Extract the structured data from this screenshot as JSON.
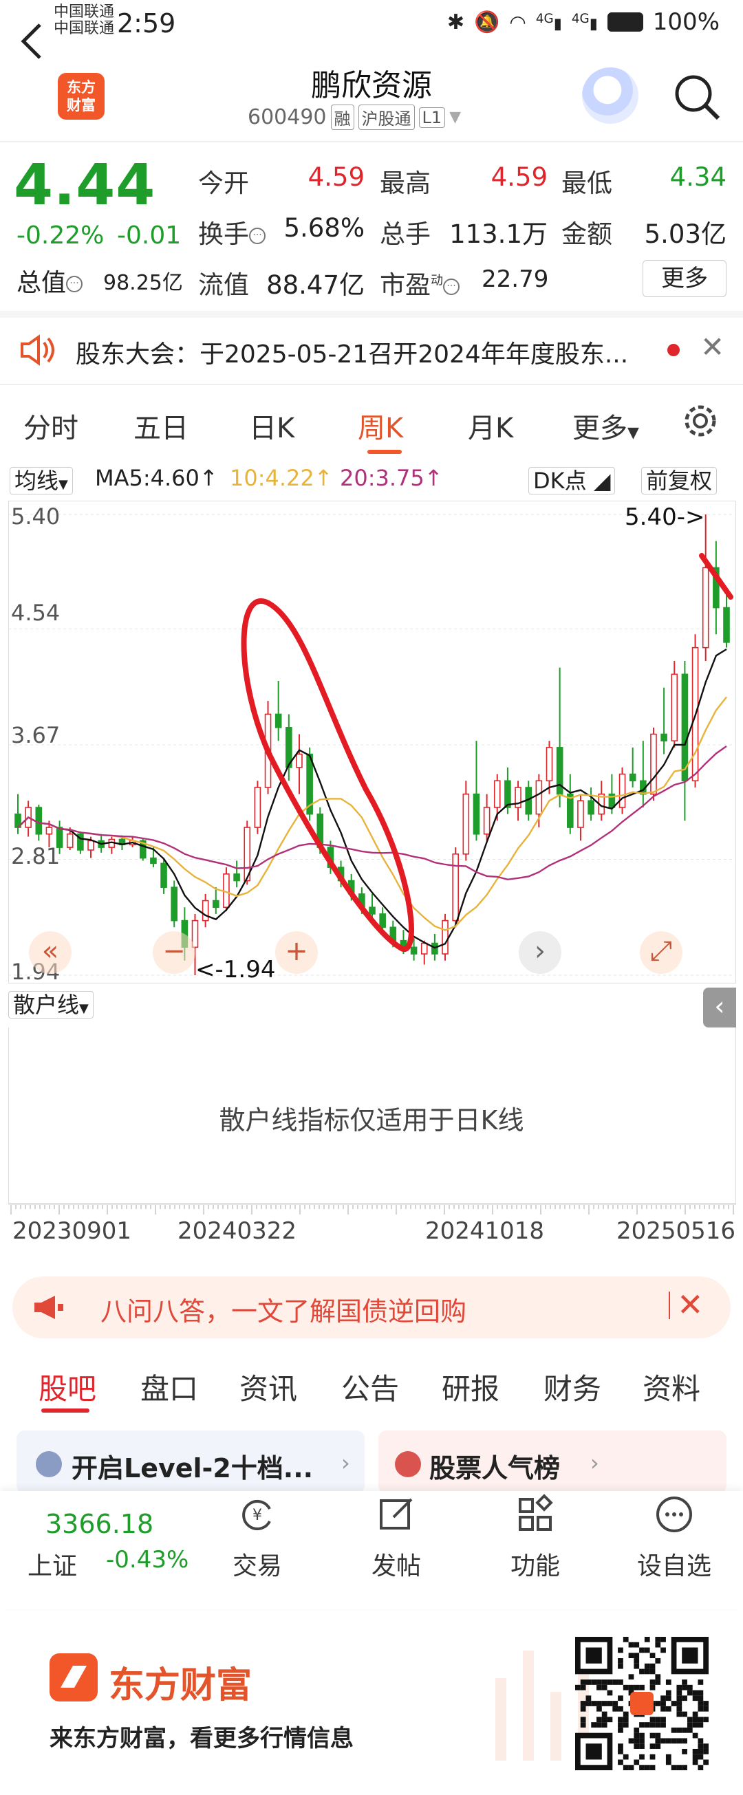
{
  "status_bar": {
    "carrier1": "中国联通",
    "carrier2": "中国联通",
    "time": "2:59",
    "battery": "100%",
    "network1": "4G",
    "network2": "4G"
  },
  "header": {
    "logo_line1": "东方",
    "logo_line2": "财富",
    "stock_name": "鹏欣资源",
    "code": "600490",
    "tag_margin": "融",
    "tag_connect": "沪股通",
    "tag_level": "L1"
  },
  "quote": {
    "price": "4.44",
    "change_pct": "-0.22%",
    "change": "-0.01",
    "market_cap_label": "总值",
    "market_cap": "98.25亿",
    "open_label": "今开",
    "open": "4.59",
    "high_label": "最高",
    "high": "4.59",
    "low_label": "最低",
    "low": "4.34",
    "turnover_label": "换手",
    "turnover": "5.68%",
    "volume_label": "总手",
    "volume": "113.1万",
    "amount_label": "金额",
    "amount": "5.03亿",
    "float_cap_label": "流值",
    "float_cap": "88.47亿",
    "pe_label": "市盈",
    "pe_sup": "动",
    "pe": "22.79",
    "more_label": "更多"
  },
  "notice": {
    "text": "股东大会：于2025-05-21召开2024年年度股东..."
  },
  "kline_tabs": {
    "items": [
      "分时",
      "五日",
      "日K",
      "周K",
      "月K",
      "更多"
    ],
    "active": "周K"
  },
  "ma_row": {
    "selector": "均线",
    "ma5": "MA5:4.60",
    "ma10": "10:4.22",
    "ma20": "20:3.75",
    "dk": "DK点",
    "adjust": "前复权"
  },
  "chart_data": {
    "type": "candlestick",
    "period": "weekly",
    "y_ticks": [
      "5.40",
      "4.54",
      "3.67",
      "2.81",
      "1.94"
    ],
    "ylim": [
      1.94,
      5.4
    ],
    "x_ticks": [
      "20230901",
      "20240322",
      "20241018",
      "20250516"
    ],
    "max_label": "5.40->",
    "min_label": "<-1.94",
    "up_color": "#e0262d",
    "down_color": "#1f9d2a",
    "ma_colors": {
      "ma5": "#111111",
      "ma10": "#e8b33b",
      "ma20": "#b0307a"
    },
    "candles": [
      {
        "o": 3.15,
        "h": 3.3,
        "l": 3.0,
        "c": 3.05
      },
      {
        "o": 3.05,
        "h": 3.25,
        "l": 2.98,
        "c": 3.2
      },
      {
        "o": 3.2,
        "h": 3.22,
        "l": 2.95,
        "c": 3.0
      },
      {
        "o": 3.0,
        "h": 3.1,
        "l": 2.9,
        "c": 3.05
      },
      {
        "o": 3.05,
        "h": 3.1,
        "l": 2.85,
        "c": 2.9
      },
      {
        "o": 2.9,
        "h": 3.05,
        "l": 2.88,
        "c": 3.0
      },
      {
        "o": 3.0,
        "h": 3.02,
        "l": 2.85,
        "c": 2.88
      },
      {
        "o": 2.88,
        "h": 2.98,
        "l": 2.82,
        "c": 2.95
      },
      {
        "o": 2.95,
        "h": 3.0,
        "l": 2.86,
        "c": 2.9
      },
      {
        "o": 2.9,
        "h": 2.98,
        "l": 2.85,
        "c": 2.96
      },
      {
        "o": 2.96,
        "h": 2.99,
        "l": 2.88,
        "c": 2.92
      },
      {
        "o": 2.92,
        "h": 2.98,
        "l": 2.9,
        "c": 2.95
      },
      {
        "o": 2.95,
        "h": 2.97,
        "l": 2.8,
        "c": 2.82
      },
      {
        "o": 2.82,
        "h": 2.9,
        "l": 2.75,
        "c": 2.78
      },
      {
        "o": 2.78,
        "h": 2.82,
        "l": 2.55,
        "c": 2.6
      },
      {
        "o": 2.6,
        "h": 2.65,
        "l": 2.3,
        "c": 2.35
      },
      {
        "o": 2.35,
        "h": 2.45,
        "l": 2.05,
        "c": 2.15
      },
      {
        "o": 2.15,
        "h": 2.4,
        "l": 1.94,
        "c": 2.35
      },
      {
        "o": 2.35,
        "h": 2.55,
        "l": 2.3,
        "c": 2.5
      },
      {
        "o": 2.5,
        "h": 2.6,
        "l": 2.4,
        "c": 2.45
      },
      {
        "o": 2.45,
        "h": 2.75,
        "l": 2.42,
        "c": 2.7
      },
      {
        "o": 2.7,
        "h": 2.8,
        "l": 2.6,
        "c": 2.65
      },
      {
        "o": 2.65,
        "h": 3.1,
        "l": 2.62,
        "c": 3.05
      },
      {
        "o": 3.05,
        "h": 3.4,
        "l": 3.0,
        "c": 3.35
      },
      {
        "o": 3.35,
        "h": 4.0,
        "l": 3.3,
        "c": 3.9
      },
      {
        "o": 3.9,
        "h": 4.15,
        "l": 3.7,
        "c": 3.8
      },
      {
        "o": 3.8,
        "h": 3.9,
        "l": 3.4,
        "c": 3.5
      },
      {
        "o": 3.5,
        "h": 3.75,
        "l": 3.3,
        "c": 3.6
      },
      {
        "o": 3.6,
        "h": 3.65,
        "l": 3.1,
        "c": 3.15
      },
      {
        "o": 3.15,
        "h": 3.2,
        "l": 2.85,
        "c": 2.9
      },
      {
        "o": 2.9,
        "h": 2.95,
        "l": 2.7,
        "c": 2.75
      },
      {
        "o": 2.75,
        "h": 2.8,
        "l": 2.6,
        "c": 2.65
      },
      {
        "o": 2.65,
        "h": 2.7,
        "l": 2.5,
        "c": 2.55
      },
      {
        "o": 2.55,
        "h": 2.6,
        "l": 2.4,
        "c": 2.45
      },
      {
        "o": 2.45,
        "h": 2.55,
        "l": 2.35,
        "c": 2.4
      },
      {
        "o": 2.4,
        "h": 2.45,
        "l": 2.25,
        "c": 2.3
      },
      {
        "o": 2.3,
        "h": 2.35,
        "l": 2.15,
        "c": 2.2
      },
      {
        "o": 2.2,
        "h": 2.28,
        "l": 2.1,
        "c": 2.15
      },
      {
        "o": 2.15,
        "h": 2.22,
        "l": 2.05,
        "c": 2.1
      },
      {
        "o": 2.1,
        "h": 2.2,
        "l": 2.02,
        "c": 2.18
      },
      {
        "o": 2.18,
        "h": 2.25,
        "l": 2.05,
        "c": 2.1
      },
      {
        "o": 2.1,
        "h": 2.4,
        "l": 2.05,
        "c": 2.35
      },
      {
        "o": 2.35,
        "h": 2.9,
        "l": 2.3,
        "c": 2.85
      },
      {
        "o": 2.85,
        "h": 3.4,
        "l": 2.8,
        "c": 3.3
      },
      {
        "o": 3.3,
        "h": 3.7,
        "l": 2.95,
        "c": 3.0
      },
      {
        "o": 3.0,
        "h": 3.3,
        "l": 2.95,
        "c": 3.2
      },
      {
        "o": 3.2,
        "h": 3.45,
        "l": 3.1,
        "c": 3.4
      },
      {
        "o": 3.4,
        "h": 3.5,
        "l": 3.15,
        "c": 3.2
      },
      {
        "o": 3.2,
        "h": 3.4,
        "l": 3.1,
        "c": 3.35
      },
      {
        "o": 3.35,
        "h": 3.4,
        "l": 3.1,
        "c": 3.15
      },
      {
        "o": 3.15,
        "h": 3.45,
        "l": 3.05,
        "c": 3.4
      },
      {
        "o": 3.4,
        "h": 3.7,
        "l": 3.3,
        "c": 3.65
      },
      {
        "o": 3.65,
        "h": 4.25,
        "l": 3.2,
        "c": 3.3
      },
      {
        "o": 3.3,
        "h": 3.45,
        "l": 3.0,
        "c": 3.05
      },
      {
        "o": 3.05,
        "h": 3.3,
        "l": 2.95,
        "c": 3.25
      },
      {
        "o": 3.25,
        "h": 3.35,
        "l": 3.1,
        "c": 3.15
      },
      {
        "o": 3.15,
        "h": 3.4,
        "l": 3.1,
        "c": 3.3
      },
      {
        "o": 3.3,
        "h": 3.45,
        "l": 3.15,
        "c": 3.2
      },
      {
        "o": 3.2,
        "h": 3.5,
        "l": 3.15,
        "c": 3.45
      },
      {
        "o": 3.45,
        "h": 3.65,
        "l": 3.35,
        "c": 3.4
      },
      {
        "o": 3.4,
        "h": 3.7,
        "l": 3.2,
        "c": 3.3
      },
      {
        "o": 3.3,
        "h": 3.8,
        "l": 3.25,
        "c": 3.75
      },
      {
        "o": 3.75,
        "h": 4.1,
        "l": 3.6,
        "c": 3.7
      },
      {
        "o": 3.7,
        "h": 4.3,
        "l": 3.65,
        "c": 4.2
      },
      {
        "o": 4.2,
        "h": 4.3,
        "l": 3.1,
        "c": 3.4
      },
      {
        "o": 3.4,
        "h": 4.5,
        "l": 3.35,
        "c": 4.4
      },
      {
        "o": 4.4,
        "h": 5.4,
        "l": 4.3,
        "c": 5.0
      },
      {
        "o": 5.0,
        "h": 5.2,
        "l": 4.5,
        "c": 4.7
      },
      {
        "o": 4.7,
        "h": 4.8,
        "l": 4.4,
        "c": 4.44
      }
    ]
  },
  "sub_indicator": {
    "selector": "散户线",
    "message": "散户线指标仅适用于日K线"
  },
  "ad_banner": {
    "text": "八问八答，一文了解国债逆回购"
  },
  "bottom_tabs": {
    "items": [
      "股吧",
      "盘口",
      "资讯",
      "公告",
      "研报",
      "财务",
      "资料"
    ],
    "active": "股吧"
  },
  "cards": {
    "level2": "开启Level-2十档...",
    "popularity": "股票人气榜"
  },
  "footer": {
    "index_value": "3366.18",
    "index_name": "上证",
    "index_change": "-0.43%",
    "trade": "交易",
    "post": "发帖",
    "functions": "功能",
    "watchlist": "设自选"
  },
  "brand": {
    "name": "东方财富",
    "slogan": "来东方财富，看更多行情信息"
  }
}
